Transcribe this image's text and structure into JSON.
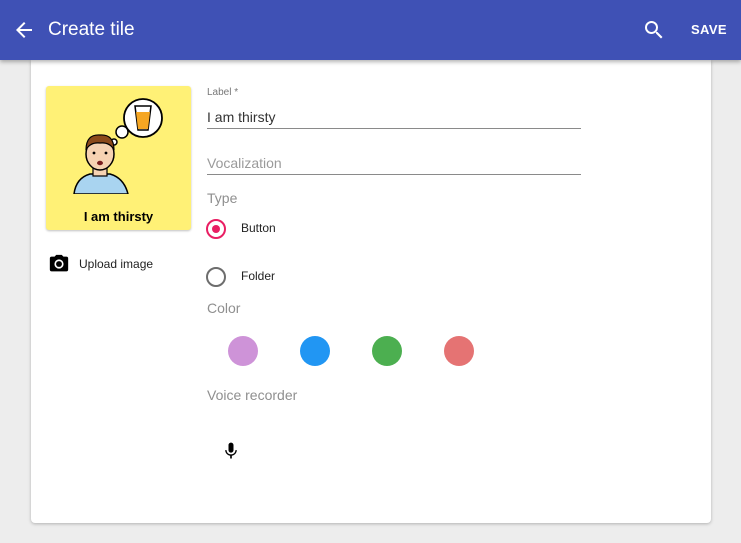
{
  "appbar": {
    "title": "Create tile",
    "save_label": "SAVE"
  },
  "tile": {
    "label": "I am thirsty",
    "background": "#fff176"
  },
  "upload": {
    "label": "Upload image"
  },
  "form": {
    "label_caption": "Label *",
    "label_value": "I am thirsty",
    "vocalization_placeholder": "Vocalization",
    "type_label": "Type",
    "type_options": [
      "Button",
      "Folder"
    ],
    "type_selected": "Button",
    "color_label": "Color",
    "colors": [
      "#ce93d8",
      "#2196f3",
      "#4caf50",
      "#e57373"
    ],
    "voice_recorder_label": "Voice recorder"
  },
  "theme": {
    "primary": "#3f51b5",
    "accent": "#e91e63"
  }
}
